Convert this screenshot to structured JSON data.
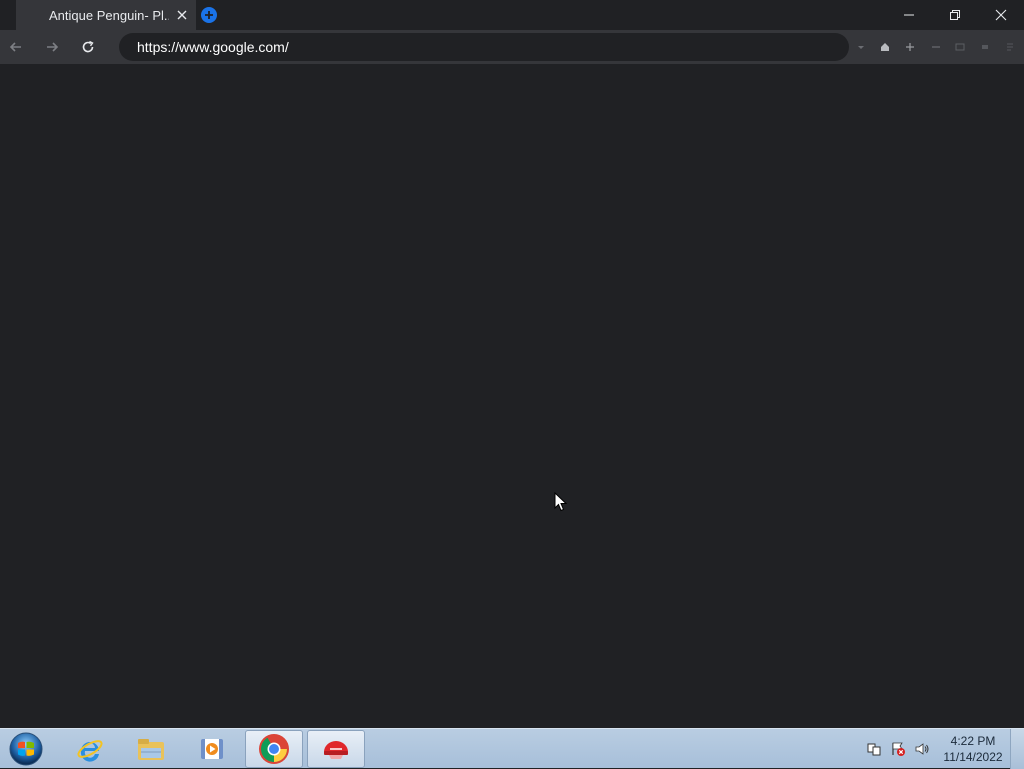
{
  "browser": {
    "tab": {
      "title": "Antique Penguin- Pl..."
    },
    "address_bar": {
      "url": "https://www.google.com/"
    },
    "icons": {
      "back": "back-arrow-icon",
      "forward": "forward-arrow-icon",
      "reload": "reload-icon",
      "new_tab": "new-tab-icon",
      "close_tab": "close-icon",
      "minimize": "minimize-icon",
      "maximize": "restore-icon",
      "close_window": "close-icon"
    }
  },
  "taskbar": {
    "clock": {
      "time": "4:22 PM",
      "date": "11/14/2022"
    },
    "apps": [
      "internet-explorer",
      "file-explorer",
      "media-player",
      "chrome",
      "app-red-helmet"
    ]
  },
  "colors": {
    "page_background": "#202124",
    "toolbar": "#35363a",
    "accent": "#1a73e8"
  }
}
